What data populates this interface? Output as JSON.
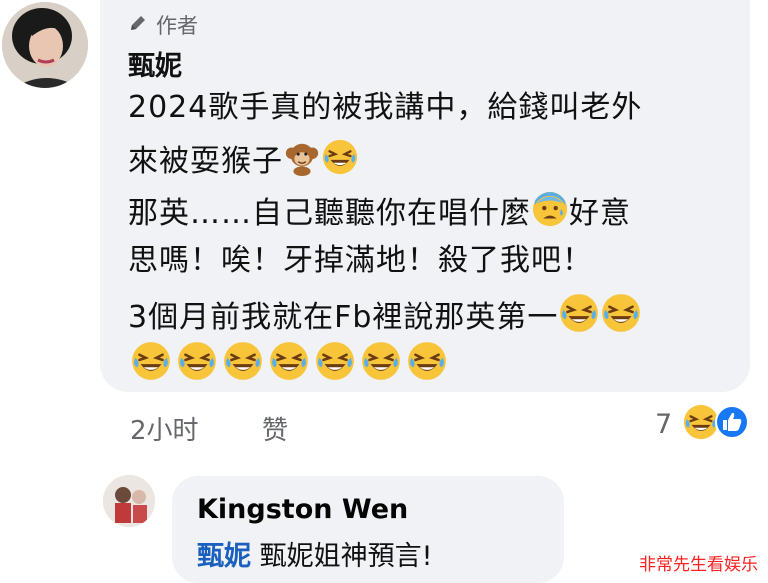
{
  "post": {
    "author_badge": "作者",
    "author_name": "甄妮",
    "lines": [
      "2024歌手真的被我講中，給錢叫老外",
      "來被耍猴子",
      "那英……自己聽聽你在唱什麼",
      "好意",
      "思嗎！唉！牙掉滿地！殺了我吧！",
      "3個月前我就在Fb裡說那英第一"
    ],
    "time": "2小时",
    "like_label": "赞",
    "reaction_count": "7",
    "icons": {
      "badge": "pencil-icon",
      "monkey": "monkey-emoji-icon",
      "laugh": "laughing-crying-emoji-icon",
      "worried": "anxious-sweat-emoji-icon",
      "like": "like-thumb-icon"
    }
  },
  "reply": {
    "author_name": "Kingston Wen",
    "mention": "甄妮",
    "text": " 甄妮姐神預言!"
  },
  "watermark": "非常先生看娱乐",
  "colors": {
    "bubble": "#f0f2f5",
    "meta_text": "#65676b",
    "mention": "#1b5fbf",
    "emoji_yellow": "#f7c43a",
    "like_blue": "#1877f2",
    "watermark": "#ff2020"
  }
}
